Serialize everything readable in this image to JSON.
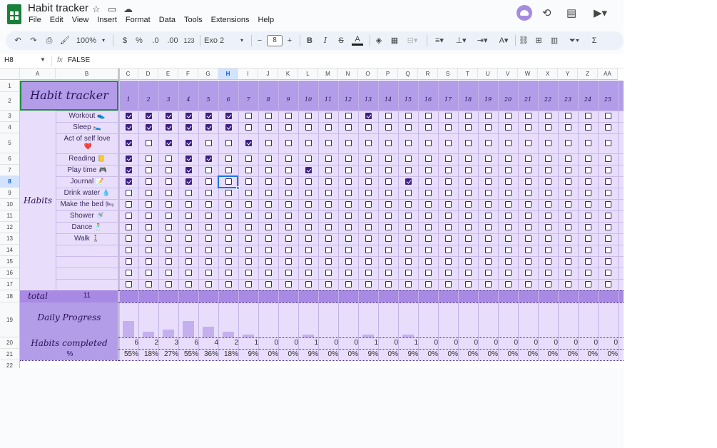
{
  "app": {
    "doc_title": "Habit tracker",
    "menu": [
      "File",
      "Edit",
      "View",
      "Insert",
      "Format",
      "Data",
      "Tools",
      "Extensions",
      "Help"
    ]
  },
  "toolbar": {
    "zoom": "100%",
    "currency": "$",
    "percent": "%",
    "dec_decrease": ".0",
    "dec_increase": ".00",
    "number_format": "123",
    "font": "Exo 2",
    "font_size": "8",
    "bold": "B",
    "italic": "I"
  },
  "formula_bar": {
    "name_box": "H8",
    "fx": "fx",
    "content": "FALSE"
  },
  "columns": [
    "A",
    "B",
    "C",
    "D",
    "E",
    "F",
    "G",
    "H",
    "I",
    "J",
    "K",
    "L",
    "M",
    "N",
    "O",
    "P",
    "Q",
    "R",
    "S",
    "T",
    "U",
    "V",
    "W",
    "X",
    "Y",
    "Z",
    "AA"
  ],
  "rows": [
    "1",
    "2",
    "3",
    "4",
    "5",
    "6",
    "7",
    "8",
    "9",
    "10",
    "11",
    "12",
    "13",
    "14",
    "15",
    "16",
    "17",
    "18",
    "19",
    "20",
    "21",
    "22"
  ],
  "sheet": {
    "title": "Habit tracker",
    "habits_label": "Habits",
    "days": [
      "1",
      "2",
      "3",
      "4",
      "5",
      "6",
      "7",
      "8",
      "9",
      "10",
      "11",
      "12",
      "13",
      "14",
      "15",
      "16",
      "17",
      "18",
      "19",
      "20",
      "21",
      "22",
      "23",
      "24",
      "25"
    ],
    "habits": [
      {
        "name": "Workout",
        "icon": "👟",
        "checks": [
          1,
          1,
          1,
          1,
          1,
          1,
          0,
          0,
          0,
          0,
          0,
          0,
          1,
          0,
          0,
          0,
          0,
          0,
          0,
          0,
          0,
          0,
          0,
          0,
          0
        ]
      },
      {
        "name": "Sleep",
        "icon": "🛌",
        "checks": [
          1,
          1,
          1,
          1,
          1,
          1,
          0,
          0,
          0,
          0,
          0,
          0,
          0,
          0,
          0,
          0,
          0,
          0,
          0,
          0,
          0,
          0,
          0,
          0,
          0
        ]
      },
      {
        "name": "Act of self love",
        "icon": "❤️",
        "checks": [
          1,
          0,
          1,
          1,
          0,
          0,
          1,
          0,
          0,
          0,
          0,
          0,
          0,
          0,
          0,
          0,
          0,
          0,
          0,
          0,
          0,
          0,
          0,
          0,
          0
        ]
      },
      {
        "name": "Reading",
        "icon": "📒",
        "checks": [
          1,
          0,
          0,
          1,
          1,
          0,
          0,
          0,
          0,
          0,
          0,
          0,
          0,
          0,
          0,
          0,
          0,
          0,
          0,
          0,
          0,
          0,
          0,
          0,
          0
        ]
      },
      {
        "name": "Play time",
        "icon": "🎮",
        "checks": [
          1,
          0,
          0,
          1,
          0,
          0,
          0,
          0,
          0,
          1,
          0,
          0,
          0,
          0,
          0,
          0,
          0,
          0,
          0,
          0,
          0,
          0,
          0,
          0,
          0
        ]
      },
      {
        "name": "Journal",
        "icon": "📝",
        "checks": [
          1,
          0,
          0,
          1,
          0,
          0,
          0,
          0,
          0,
          0,
          0,
          0,
          0,
          0,
          1,
          0,
          0,
          0,
          0,
          0,
          0,
          0,
          0,
          0,
          0
        ]
      },
      {
        "name": "Drink water",
        "icon": "💧",
        "checks": [
          0,
          0,
          0,
          0,
          0,
          0,
          0,
          0,
          0,
          0,
          0,
          0,
          0,
          0,
          0,
          0,
          0,
          0,
          0,
          0,
          0,
          0,
          0,
          0,
          0
        ]
      },
      {
        "name": "Make the bed",
        "icon": "🛏",
        "checks": [
          0,
          0,
          0,
          0,
          0,
          0,
          0,
          0,
          0,
          0,
          0,
          0,
          0,
          0,
          0,
          0,
          0,
          0,
          0,
          0,
          0,
          0,
          0,
          0,
          0
        ]
      },
      {
        "name": "Shower",
        "icon": "🚿",
        "checks": [
          0,
          0,
          0,
          0,
          0,
          0,
          0,
          0,
          0,
          0,
          0,
          0,
          0,
          0,
          0,
          0,
          0,
          0,
          0,
          0,
          0,
          0,
          0,
          0,
          0
        ]
      },
      {
        "name": "Dance",
        "icon": "🕺",
        "checks": [
          0,
          0,
          0,
          0,
          0,
          0,
          0,
          0,
          0,
          0,
          0,
          0,
          0,
          0,
          0,
          0,
          0,
          0,
          0,
          0,
          0,
          0,
          0,
          0,
          0
        ]
      },
      {
        "name": "Walk",
        "icon": "🚶",
        "checks": [
          0,
          0,
          0,
          0,
          0,
          0,
          0,
          0,
          0,
          0,
          0,
          0,
          0,
          0,
          0,
          0,
          0,
          0,
          0,
          0,
          0,
          0,
          0,
          0,
          0
        ]
      },
      {
        "name": "",
        "icon": "",
        "checks": [
          0,
          0,
          0,
          0,
          0,
          0,
          0,
          0,
          0,
          0,
          0,
          0,
          0,
          0,
          0,
          0,
          0,
          0,
          0,
          0,
          0,
          0,
          0,
          0,
          0
        ]
      },
      {
        "name": "",
        "icon": "",
        "checks": [
          0,
          0,
          0,
          0,
          0,
          0,
          0,
          0,
          0,
          0,
          0,
          0,
          0,
          0,
          0,
          0,
          0,
          0,
          0,
          0,
          0,
          0,
          0,
          0,
          0
        ]
      },
      {
        "name": "",
        "icon": "",
        "checks": [
          0,
          0,
          0,
          0,
          0,
          0,
          0,
          0,
          0,
          0,
          0,
          0,
          0,
          0,
          0,
          0,
          0,
          0,
          0,
          0,
          0,
          0,
          0,
          0,
          0
        ]
      },
      {
        "name": "",
        "icon": "",
        "checks": [
          0,
          0,
          0,
          0,
          0,
          0,
          0,
          0,
          0,
          0,
          0,
          0,
          0,
          0,
          0,
          0,
          0,
          0,
          0,
          0,
          0,
          0,
          0,
          0,
          0
        ]
      }
    ],
    "total_label": "total",
    "total_value": "11",
    "progress_label": "Daily Progress",
    "completed_label": "Habits completed",
    "percent_label": "%",
    "completed": [
      "6",
      "2",
      "3",
      "6",
      "4",
      "2",
      "1",
      "0",
      "0",
      "1",
      "0",
      "0",
      "1",
      "0",
      "1",
      "0",
      "0",
      "0",
      "0",
      "0",
      "0",
      "0",
      "0",
      "0",
      "0"
    ],
    "percents": [
      "55%",
      "18%",
      "27%",
      "55%",
      "36%",
      "18%",
      "9%",
      "0%",
      "0%",
      "9%",
      "0%",
      "0%",
      "9%",
      "0%",
      "9%",
      "0%",
      "0%",
      "0%",
      "0%",
      "0%",
      "0%",
      "0%",
      "0%",
      "0%",
      "0%"
    ],
    "progress_fractions": [
      0.55,
      0.18,
      0.27,
      0.55,
      0.36,
      0.18,
      0.09,
      0,
      0,
      0.09,
      0,
      0,
      0.09,
      0,
      0.09,
      0,
      0,
      0,
      0,
      0,
      0,
      0,
      0,
      0,
      0
    ],
    "selected_cell": "H8"
  },
  "colors": {
    "header_purple": "#b39ce8",
    "body_purple": "#e8defb",
    "total_purple": "#a889e3",
    "checkbox_fill": "#3d1f86"
  }
}
